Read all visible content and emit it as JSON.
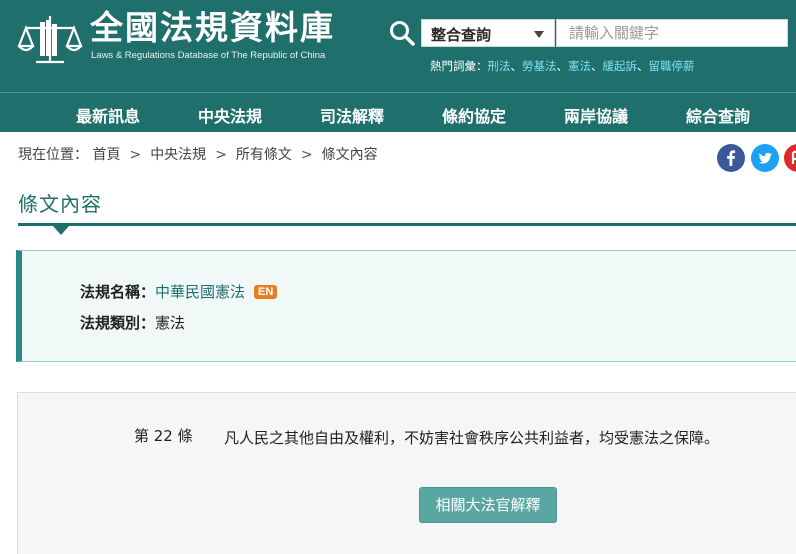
{
  "header": {
    "site_title": "全國法規資料庫",
    "site_subtitle": "Laws & Regulations Database of The Republic of China",
    "search": {
      "scope_selected": "整合查詢",
      "keyword_placeholder": "請輸入關鍵字"
    },
    "hot_keywords": {
      "label": "熱門詞彙：",
      "items": [
        "刑法",
        "勞基法",
        "憲法",
        "緩起訴",
        "留職停薪"
      ],
      "separator": "、"
    }
  },
  "nav": {
    "items": [
      "最新訊息",
      "中央法規",
      "司法解釋",
      "條約協定",
      "兩岸協議",
      "綜合查詢"
    ]
  },
  "breadcrumb": {
    "prefix": "現在位置：",
    "items": [
      "首頁",
      "中央法規",
      "所有條文",
      "條文內容"
    ],
    "separator": ">"
  },
  "share": {
    "icons": [
      "facebook-icon",
      "twitter-icon",
      "plurk-icon"
    ],
    "colors": [
      "#3b5998",
      "#1da1f2",
      "#e02a2a"
    ]
  },
  "section": {
    "title": "條文內容"
  },
  "law_info": {
    "name_label": "法規名稱：",
    "name_value": "中華民國憲法",
    "en_badge": "EN",
    "category_label": "法規類別：",
    "category_value": "憲法"
  },
  "article": {
    "number_text": "第 22 條",
    "content": "凡人民之其他自由及權利，不妨害社會秩序公共利益者，均受憲法之保障。",
    "interpretation_button": "相關大法官解釋"
  },
  "colors": {
    "brand": "#1f6f6d",
    "link": "#7fe0f0",
    "badge": "#e67e22",
    "button": "#5aa6a3"
  }
}
